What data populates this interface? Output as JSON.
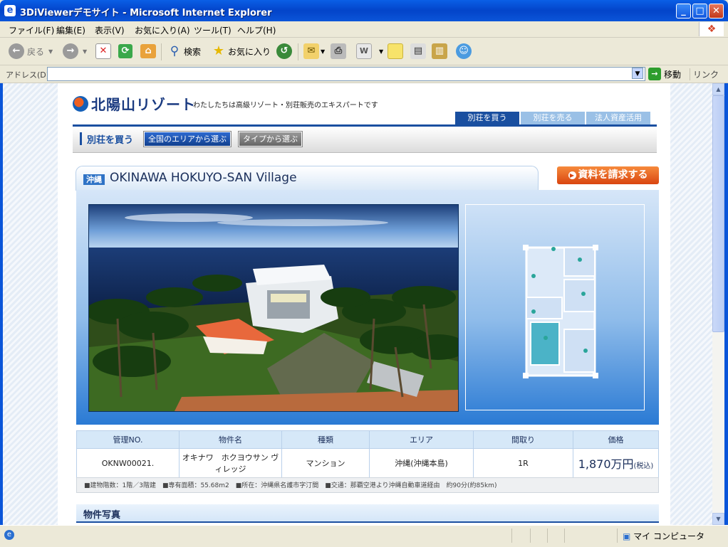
{
  "window": {
    "title": "3DiViewerデモサイト - Microsoft Internet Explorer"
  },
  "menu": [
    "ファイル(F)",
    "編集(E)",
    "表示(V)",
    "お気に入り(A)",
    "ツール(T)",
    "ヘルプ(H)"
  ],
  "toolbar": {
    "back_label": "戻る",
    "search_label": "検索",
    "favorites_label": "お気に入り"
  },
  "address": {
    "label": "アドレス(D)",
    "value": "",
    "go_label": "移動",
    "links_label": "リンク"
  },
  "site": {
    "logo": "北陽山リゾート",
    "tagline": "わたしたちは高級リゾート・別荘販売のエキスパートです",
    "tabs": [
      "別荘を買う",
      "別荘を売る",
      "法人資産活用"
    ],
    "subnav": {
      "heading": "別荘を買う",
      "area_button": "全国のエリアから選ぶ",
      "type_button": "タイプから選ぶ"
    }
  },
  "property": {
    "prefecture": "沖縄",
    "name": "OKINAWA HOKUYO-SAN Village",
    "request_button": "資料を請求する",
    "table": {
      "headers": [
        "管理NO.",
        "物件名",
        "種類",
        "エリア",
        "間取り",
        "価格"
      ],
      "row": {
        "id": "OKNW00021.",
        "name": "オキナワ　ホクヨウサン ヴィレッジ",
        "type": "マンション",
        "area": "沖縄(沖縄本島)",
        "layout": "1R",
        "price": "1,870万円",
        "tax": "(税込)"
      }
    },
    "notes": "■建物階数：1階／3階建　■専有面積：55.68m2　■所在：沖縄県名護市字汀間　■交通：那覇空港より沖縄自動車道経由　約90分(約85km)",
    "photos_heading": "物件写真"
  },
  "status": {
    "zone": "マイ コンピュータ"
  }
}
